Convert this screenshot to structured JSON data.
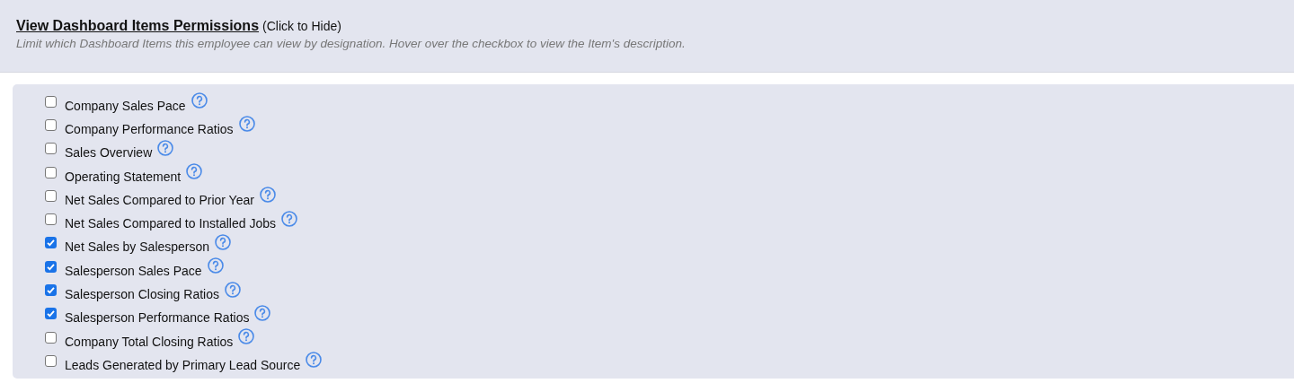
{
  "header": {
    "title": "View Dashboard Items Permissions",
    "toggle_hint": "(Click to Hide)",
    "description": "Limit which Dashboard Items this employee can view by designation. Hover over the checkbox to view the Item's description."
  },
  "items": [
    {
      "label": "Company Sales Pace",
      "checked": false
    },
    {
      "label": "Company Performance Ratios",
      "checked": false
    },
    {
      "label": "Sales Overview",
      "checked": false
    },
    {
      "label": "Operating Statement",
      "checked": false
    },
    {
      "label": "Net Sales Compared to Prior Year",
      "checked": false
    },
    {
      "label": "Net Sales Compared to Installed Jobs",
      "checked": false
    },
    {
      "label": "Net Sales by Salesperson",
      "checked": true
    },
    {
      "label": "Salesperson Sales Pace",
      "checked": true
    },
    {
      "label": "Salesperson Closing Ratios",
      "checked": true
    },
    {
      "label": "Salesperson Performance Ratios",
      "checked": true
    },
    {
      "label": "Company Total Closing Ratios",
      "checked": false
    },
    {
      "label": "Leads Generated by Primary Lead Source",
      "checked": false
    }
  ]
}
